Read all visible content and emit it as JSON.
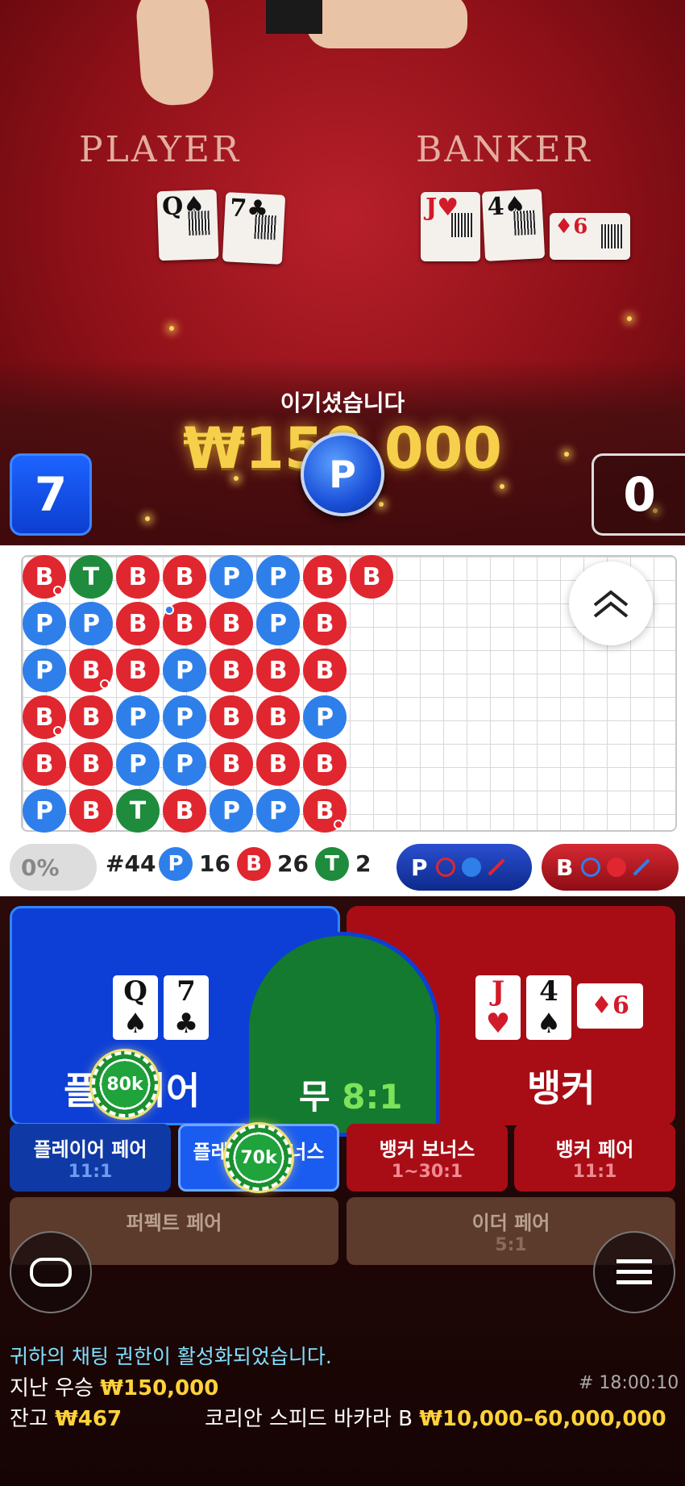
{
  "table": {
    "player_label": "PLAYER",
    "banker_label": "BANKER"
  },
  "result": {
    "title": "이기셨습니다",
    "amount": "₩150,000",
    "winner_badge": "P",
    "player_score": "7",
    "banker_score": "0"
  },
  "roadmap": {
    "columns": [
      [
        "B",
        "P",
        "P",
        "B",
        "B",
        "P"
      ],
      [
        "T",
        "P",
        "B",
        "B",
        "B",
        "B"
      ],
      [
        "B",
        "B",
        "B",
        "P",
        "P",
        "T"
      ],
      [
        "B",
        "B",
        "P",
        "P",
        "P",
        "B"
      ],
      [
        "P",
        "B",
        "B",
        "B",
        "B",
        "P"
      ],
      [
        "P",
        "P",
        "B",
        "B",
        "B",
        "P"
      ],
      [
        "B",
        "B",
        "B",
        "P",
        "B",
        "B"
      ],
      [
        "B"
      ]
    ]
  },
  "stats": {
    "percent": "0%",
    "round": "#44",
    "p_label": "P",
    "p_count": "16",
    "b_label": "B",
    "b_count": "26",
    "t_label": "T",
    "t_count": "2",
    "player_ask": "P",
    "banker_ask": "B"
  },
  "bets": {
    "player_label": "플레이어",
    "tie_label": "무",
    "tie_odds": "8:1",
    "banker_label": "뱅커",
    "player_cards": [
      "Q",
      "7"
    ],
    "banker_cards": [
      "J",
      "4",
      "6"
    ],
    "player_chip": "80k",
    "bonus_chip": "70k",
    "side": [
      {
        "name": "플레이어 페어",
        "odds": "11:1"
      },
      {
        "name": "플레이어 보너스",
        "odds": ""
      },
      {
        "name": "뱅커 보너스",
        "odds": "1~30:1"
      },
      {
        "name": "뱅커 페어",
        "odds": "11:1"
      }
    ],
    "perfect_pair": "퍼펙트 페어",
    "either_pair": "이더 페어",
    "either_odds": "5:1"
  },
  "footer": {
    "chat_notice": "귀하의 채팅 권한이 활성화되었습니다.",
    "last_win_label": "지난 우승",
    "last_win": "₩150,000",
    "time": "# 18:00:10",
    "balance_label": "잔고",
    "balance": "₩467",
    "table_name": "코리안 스피드 바카라 B",
    "limits": "₩10,000–60,000,000"
  },
  "colors": {
    "player": "#0d3fd6",
    "banker": "#a80d16",
    "tie": "#137a2f",
    "gold": "#ffd23a"
  }
}
